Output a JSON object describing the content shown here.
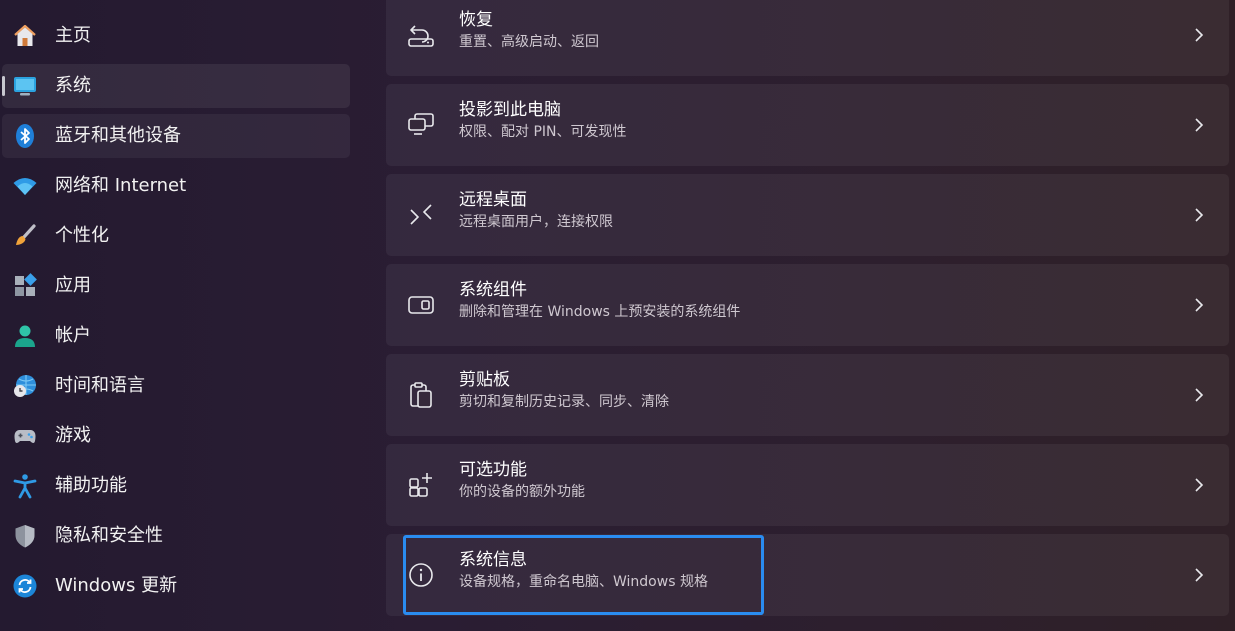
{
  "sidebar": {
    "items": [
      {
        "label": "主页",
        "icon": "home-icon"
      },
      {
        "label": "系统",
        "icon": "system-display-icon",
        "selected": true
      },
      {
        "label": "蓝牙和其他设备",
        "icon": "bluetooth-icon"
      },
      {
        "label": "网络和 Internet",
        "icon": "wifi-icon"
      },
      {
        "label": "个性化",
        "icon": "paintbrush-icon"
      },
      {
        "label": "应用",
        "icon": "apps-icon"
      },
      {
        "label": "帐户",
        "icon": "account-icon"
      },
      {
        "label": "时间和语言",
        "icon": "globe-clock-icon"
      },
      {
        "label": "游戏",
        "icon": "gamepad-icon"
      },
      {
        "label": "辅助功能",
        "icon": "accessibility-icon"
      },
      {
        "label": "隐私和安全性",
        "icon": "shield-icon"
      },
      {
        "label": "Windows 更新",
        "icon": "update-icon"
      }
    ]
  },
  "settings": {
    "cards": [
      {
        "title": "恢复",
        "subtitle": "重置、高级启动、返回",
        "icon": "recovery-icon"
      },
      {
        "title": "投影到此电脑",
        "subtitle": "权限、配对 PIN、可发现性",
        "icon": "project-icon"
      },
      {
        "title": "远程桌面",
        "subtitle": "远程桌面用户，连接权限",
        "icon": "remote-desktop-icon"
      },
      {
        "title": "系统组件",
        "subtitle": "删除和管理在 Windows 上预安装的系统组件",
        "icon": "system-components-icon"
      },
      {
        "title": "剪贴板",
        "subtitle": "剪切和复制历史记录、同步、清除",
        "icon": "clipboard-icon"
      },
      {
        "title": "可选功能",
        "subtitle": "你的设备的额外功能",
        "icon": "optional-features-icon"
      },
      {
        "title": "系统信息",
        "subtitle": "设备规格，重命名电脑、Windows 规格",
        "icon": "info-icon",
        "focused": true
      }
    ]
  },
  "colors": {
    "accent": "#2a8cf0",
    "background": "#2a1d33"
  }
}
